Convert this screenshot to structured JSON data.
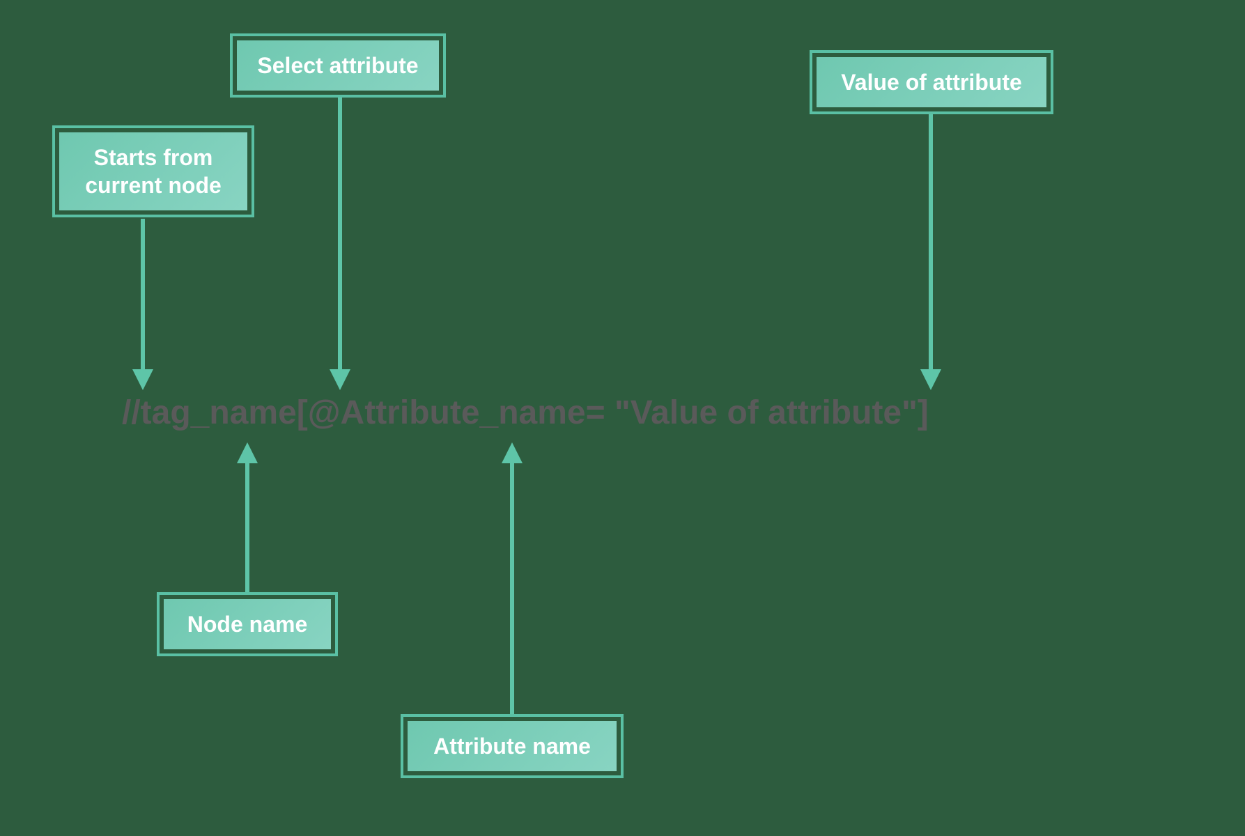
{
  "labels": {
    "starts_from": "Starts from\ncurrent node",
    "select_attribute": "Select attribute",
    "value_of_attribute": "Value of attribute",
    "node_name": "Node name",
    "attribute_name": "Attribute name"
  },
  "xpath_expression": "//tag_name[@Attribute_name= \"Value of attribute\"]",
  "colors": {
    "background": "#2d5c3e",
    "box_border": "#5ac0a4",
    "box_gradient_start": "#6fc8b0",
    "box_gradient_end": "#88d4c2",
    "arrow": "#5ec5a8",
    "text_label": "#ffffff",
    "text_xpath": "#5a5a5a"
  },
  "arrows": {
    "starts_from": {
      "direction": "down",
      "from": "starts_from_box",
      "to": "//"
    },
    "select_attribute": {
      "direction": "down",
      "from": "select_attribute_box",
      "to": "@"
    },
    "value_of_attribute": {
      "direction": "down",
      "from": "value_of_attribute_box",
      "to": "Value of attribute"
    },
    "node_name": {
      "direction": "up",
      "from": "node_name_box",
      "to": "tag_name"
    },
    "attribute_name": {
      "direction": "up",
      "from": "attribute_name_box",
      "to": "Attribute_name"
    }
  }
}
